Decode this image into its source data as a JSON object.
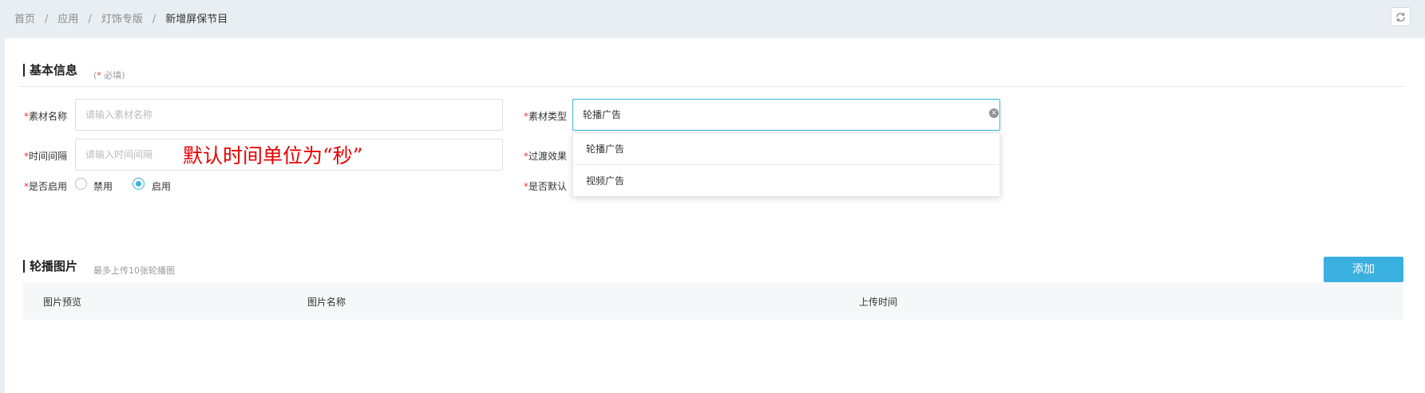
{
  "breadcrumb": {
    "home": "首页",
    "apps": "应用",
    "edition": "灯饰专版",
    "current": "新增屏保节目",
    "separator": "/"
  },
  "toolbar": {
    "refresh_icon": "refresh-icon"
  },
  "basic_info": {
    "title": "基本信息",
    "required_star": "*",
    "required_text": " 必填)",
    "required_open": "("
  },
  "form": {
    "required_mark": "*",
    "material_name": {
      "label": "素材名称",
      "placeholder": "请输入素材名称",
      "value": ""
    },
    "material_type": {
      "label": "素材类型",
      "value": "轮播广告"
    },
    "interval": {
      "label": "时间间隔",
      "placeholder": "请输入时间间隔",
      "value": ""
    },
    "transition": {
      "label": "过渡效果"
    },
    "enabled": {
      "label": "是否启用",
      "options": [
        "禁用",
        "启用"
      ],
      "selected": "启用"
    },
    "is_default": {
      "label": "是否默认"
    }
  },
  "annotation": "默认时间单位为“秒”",
  "type_dropdown": {
    "options": [
      "轮播广告",
      "视频广告"
    ]
  },
  "carousel": {
    "title": "轮播图片",
    "hint": "最多上传10张轮播图",
    "add_label": "添加",
    "columns": [
      "图片预览",
      "图片名称",
      "上传时间"
    ]
  },
  "colors": {
    "accent": "#3ab0e0",
    "required": "#e4393c",
    "annotation": "#e60000"
  }
}
